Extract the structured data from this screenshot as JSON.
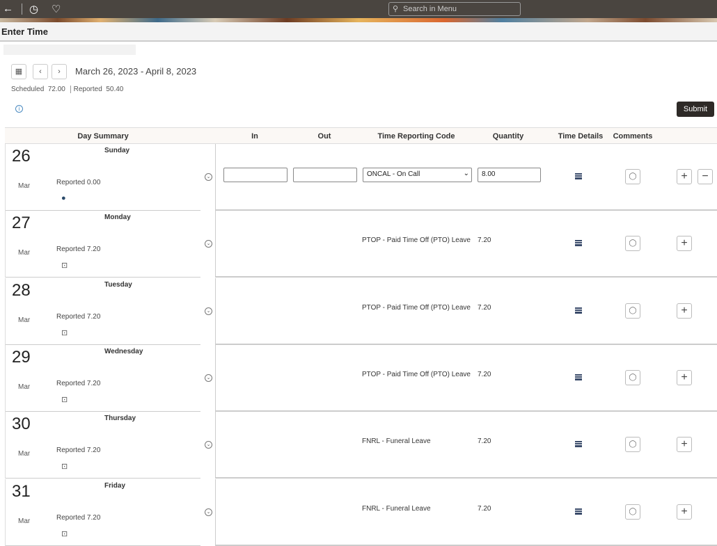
{
  "header": {
    "search_placeholder": "Search in Menu",
    "title": "Enter Time"
  },
  "period": {
    "range": "March 26, 2023 - April 8, 2023",
    "scheduled_label": "Scheduled",
    "scheduled": "72.00",
    "reported_label": "Reported",
    "reported": "50.40"
  },
  "submit_label": "Submit",
  "columns": {
    "day_summary": "Day Summary",
    "in": "In",
    "out": "Out",
    "trc": "Time Reporting Code",
    "quantity": "Quantity",
    "time_details": "Time Details",
    "comments": "Comments"
  },
  "rows": [
    {
      "day": "26",
      "month": "Mar",
      "weekday": "Sunday",
      "reported": "Reported 0.00",
      "editable": true,
      "in": "",
      "out": "",
      "trc": "ONCAL - On Call",
      "quantity": "8.00",
      "day_icon": "on-call-icon"
    },
    {
      "day": "27",
      "month": "Mar",
      "weekday": "Monday",
      "reported": "Reported 7.20",
      "trc": "PTOP - Paid Time Off (PTO) Leave",
      "quantity": "7.20",
      "day_icon": "briefcase-icon"
    },
    {
      "day": "28",
      "month": "Mar",
      "weekday": "Tuesday",
      "reported": "Reported 7.20",
      "trc": "PTOP - Paid Time Off (PTO) Leave",
      "quantity": "7.20",
      "day_icon": "briefcase-icon"
    },
    {
      "day": "29",
      "month": "Mar",
      "weekday": "Wednesday",
      "reported": "Reported 7.20",
      "trc": "PTOP - Paid Time Off (PTO) Leave",
      "quantity": "7.20",
      "day_icon": "briefcase-icon"
    },
    {
      "day": "30",
      "month": "Mar",
      "weekday": "Thursday",
      "reported": "Reported 7.20",
      "trc": "FNRL - Funeral Leave",
      "quantity": "7.20",
      "day_icon": "briefcase-icon"
    },
    {
      "day": "31",
      "month": "Mar",
      "weekday": "Friday",
      "reported": "Reported 7.20",
      "trc": "FNRL - Funeral Leave",
      "quantity": "7.20",
      "day_icon": "briefcase-icon"
    }
  ]
}
